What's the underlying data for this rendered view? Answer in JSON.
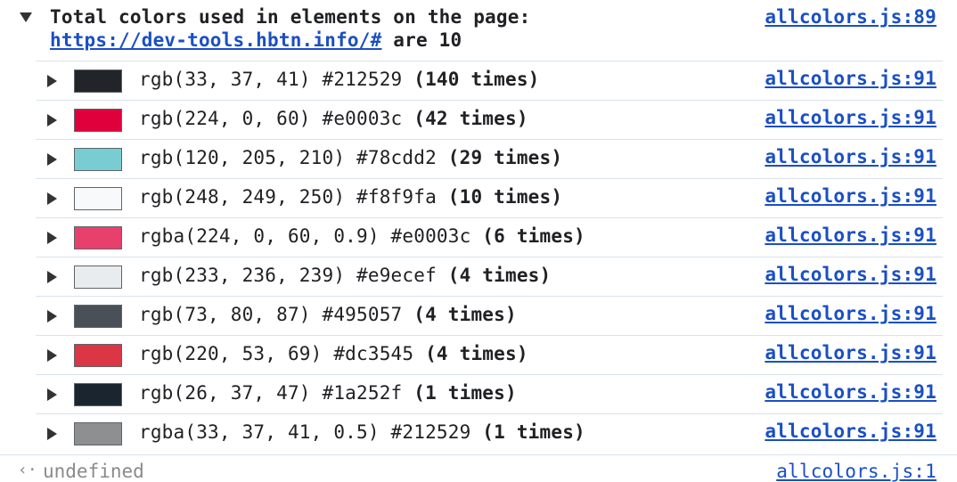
{
  "group": {
    "title_line1": "Total colors used in elements on the page:",
    "url": "https://dev-tools.hbtn.info/#",
    "title_suffix": " are 10",
    "source": "allcolors.js:89"
  },
  "rows": [
    {
      "text": "rgb(33, 37, 41) #212529 ",
      "count": "(140 times)",
      "swatch": "#212529",
      "source": "allcolors.js:91"
    },
    {
      "text": "rgb(224, 0, 60) #e0003c ",
      "count": "(42 times)",
      "swatch": "#e0003c",
      "source": "allcolors.js:91"
    },
    {
      "text": "rgb(120, 205, 210) #78cdd2 ",
      "count": "(29 times)",
      "swatch": "#78cdd2",
      "source": "allcolors.js:91"
    },
    {
      "text": "rgb(248, 249, 250) #f8f9fa ",
      "count": "(10 times)",
      "swatch": "#f8f9fa",
      "source": "allcolors.js:91"
    },
    {
      "text": "rgba(224, 0, 60, 0.9) #e0003c ",
      "count": "(6 times)",
      "swatch": "rgba(224,0,60,0.75)",
      "source": "allcolors.js:91"
    },
    {
      "text": "rgb(233, 236, 239) #e9ecef ",
      "count": "(4 times)",
      "swatch": "#e9ecef",
      "source": "allcolors.js:91"
    },
    {
      "text": "rgb(73, 80, 87) #495057 ",
      "count": "(4 times)",
      "swatch": "#495057",
      "source": "allcolors.js:91"
    },
    {
      "text": "rgb(220, 53, 69) #dc3545 ",
      "count": "(4 times)",
      "swatch": "#dc3545",
      "source": "allcolors.js:91"
    },
    {
      "text": "rgb(26, 37, 47) #1a252f ",
      "count": "(1 times)",
      "swatch": "#1a252f",
      "source": "allcolors.js:91"
    },
    {
      "text": "rgba(33, 37, 41, 0.5) #212529 ",
      "count": "(1 times)",
      "swatch": "#8e8f90",
      "source": "allcolors.js:91"
    }
  ],
  "footer": {
    "chevron": "‹·",
    "value": "undefined",
    "source": "allcolors.js:1"
  }
}
